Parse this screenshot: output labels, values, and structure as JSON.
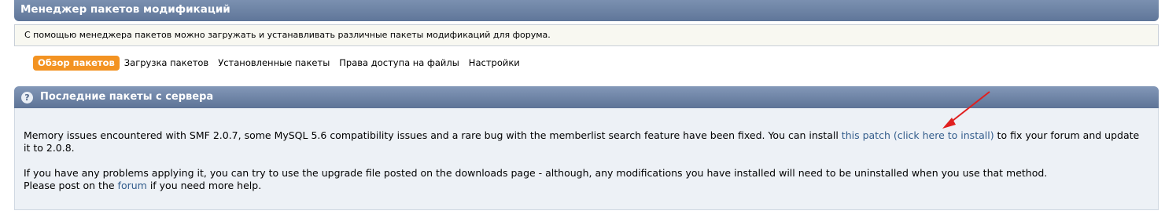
{
  "header": {
    "title": "Менеджер пакетов модификаций"
  },
  "info": {
    "text": "С помощью менеджера пакетов можно загружать и устанавливать различные пакеты модификаций для форума."
  },
  "tabs": [
    {
      "label": "Обзор пакетов",
      "active": true
    },
    {
      "label": "Загрузка пакетов"
    },
    {
      "label": "Установленные пакеты"
    },
    {
      "label": "Права доступа на файлы"
    },
    {
      "label": "Настройки"
    }
  ],
  "news": {
    "title": "Последние пакеты с сервера",
    "p1_before": "Memory issues encountered with SMF 2.0.7, some MySQL 5.6 compatibility issues and a rare bug with the memberlist search feature have been fixed. You can install ",
    "p1_link": "this patch (click here to install)",
    "p1_after": " to fix your forum and update it to 2.0.8.",
    "p2": "If you have any problems applying it, you can try to use the upgrade file posted on the downloads page - although, any modifications you have installed will need to be uninstalled when you use that method.",
    "p3_before": "Please post on the ",
    "p3_link": "forum",
    "p3_after": " if you need more help."
  },
  "colors": {
    "accent": "#f39322",
    "header": "#6b82a6",
    "link": "#335d8c",
    "arrow": "#e02020"
  },
  "icons": {
    "help": "help-icon",
    "annotation": "red-arrow-icon"
  }
}
